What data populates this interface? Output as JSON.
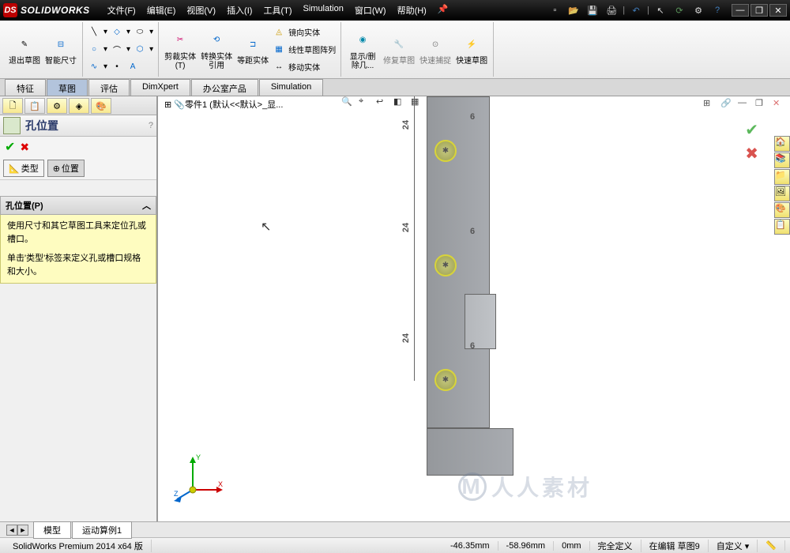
{
  "title": {
    "brand": "SOLIDWORKS",
    "logo": "DS"
  },
  "menus": [
    "文件(F)",
    "编辑(E)",
    "视图(V)",
    "插入(I)",
    "工具(T)",
    "Simulation",
    "窗口(W)",
    "帮助(H)"
  ],
  "ribbon": {
    "exit_sketch": "退出草图",
    "smart_dim": "智能尺寸",
    "trim": "剪裁实体(T)",
    "convert": "转换实体引用",
    "offset": "等距实体",
    "mirror": "镜向实体",
    "linear_pattern": "线性草图阵列",
    "move": "移动实体",
    "show_hide": "显示/删除几...",
    "repair": "修复草图",
    "quick_snap": "快速捕捉",
    "rapid_sketch": "快速草图"
  },
  "cmd_tabs": [
    "特征",
    "草图",
    "评估",
    "DimXpert",
    "办公室产品",
    "Simulation"
  ],
  "cmd_active": 1,
  "tree_root": "零件1 (默认<<默认>_显...",
  "pm": {
    "title": "孔位置",
    "sub_type": "类型",
    "sub_pos": "位置",
    "section": "孔位置(P)",
    "hint1": "使用尺寸和其它草图工具来定位孔或槽口。",
    "hint2": "单击'类型'标签来定义孔或槽口规格和大小。"
  },
  "dims": {
    "v1": "24",
    "v2": "24",
    "v3": "24",
    "h1": "6",
    "h2": "6",
    "h3": "6"
  },
  "triad": {
    "x": "X",
    "y": "Y",
    "z": "Z"
  },
  "bottom_tabs": [
    "模型",
    "运动算例1"
  ],
  "status": {
    "product": "SolidWorks Premium 2014 x64 版",
    "x": "-46.35mm",
    "y": "-58.96mm",
    "z": "0mm",
    "def": "完全定义",
    "editing": "在编辑 草图9",
    "custom": "自定义"
  },
  "watermark": "人人素材"
}
